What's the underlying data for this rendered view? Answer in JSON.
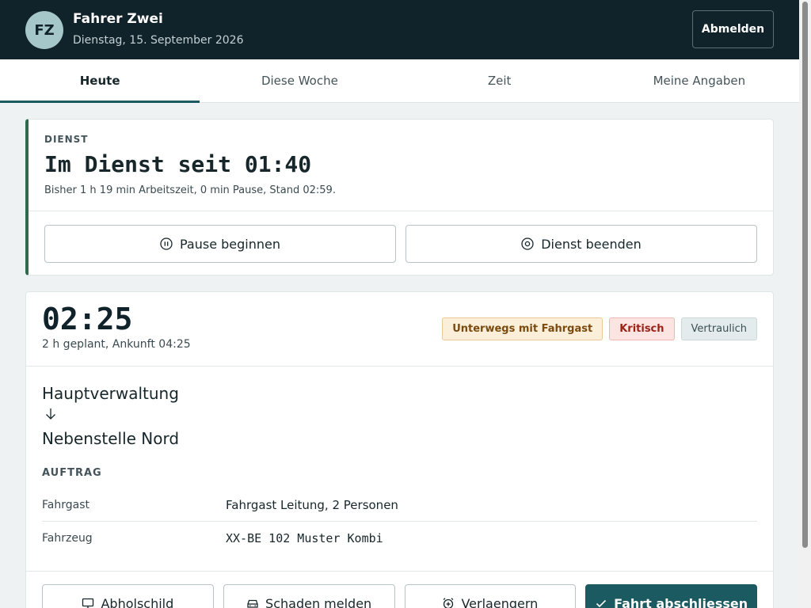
{
  "header": {
    "avatar_initials": "FZ",
    "user_name": "Fahrer Zwei",
    "date": "Dienstag, 15. September 2026",
    "logout_label": "Abmelden"
  },
  "tabs": [
    {
      "label": "Heute",
      "active": true
    },
    {
      "label": "Diese Woche",
      "active": false
    },
    {
      "label": "Zeit",
      "active": false
    },
    {
      "label": "Meine Angaben",
      "active": false
    }
  ],
  "duty": {
    "kicker": "DIENST",
    "title": "Im Dienst seit 01:40",
    "subtitle": "Bisher 1 h 19 min Arbeitszeit, 0 min Pause, Stand 02:59.",
    "pause_label": "Pause beginnen",
    "end_label": "Dienst beenden"
  },
  "trip": {
    "time": "02:25",
    "planned": "2 h geplant, Ankunft 04:25",
    "badges": {
      "status": "Unterwegs mit Fahrgast",
      "priority": "Kritisch",
      "confidential": "Vertraulich"
    },
    "from": "Hauptverwaltung",
    "to": "Nebenstelle Nord",
    "order_kicker": "AUFTRAG",
    "details": [
      {
        "label": "Fahrgast",
        "value": "Fahrgast Leitung, 2 Personen"
      },
      {
        "label": "Fahrzeug",
        "value": "XX-BE 102 Muster Kombi"
      }
    ],
    "actions": {
      "sign_label": "Abholschild",
      "damage_label": "Schaden melden",
      "extend_label": "Verlaengern",
      "finish_label": "Fahrt abschliessen"
    }
  },
  "icons": {
    "pause": "pause-circle-icon",
    "stop": "stop-circle-icon",
    "arrow": "arrow-down-icon",
    "monitor": "monitor-icon",
    "car": "car-icon",
    "alarm": "alarm-plus-icon",
    "check": "check-icon"
  },
  "colors": {
    "header_bg": "#10222a",
    "accent": "#1c5a62",
    "duty_accent": "#2e6b4d"
  }
}
